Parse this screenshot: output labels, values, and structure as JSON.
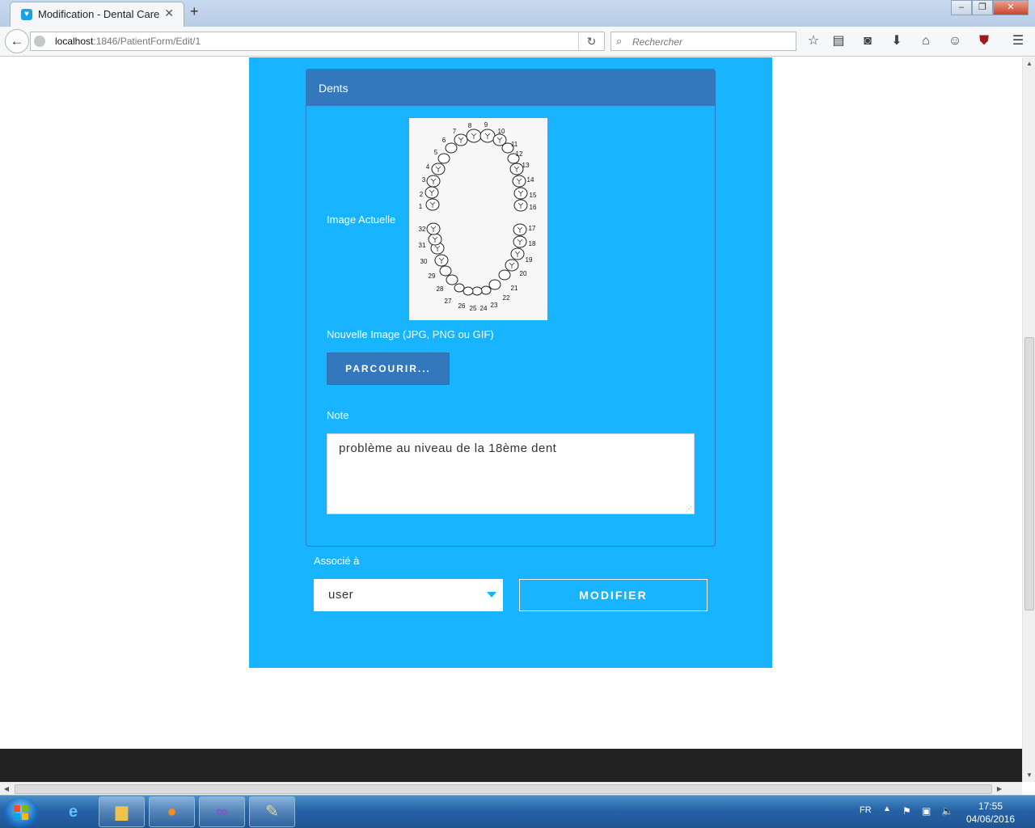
{
  "browser": {
    "tab_title": "Modification - Dental Care",
    "tab_close": "✕",
    "new_tab": "+",
    "url_host": "localhost",
    "url_path": ":1846/PatientForm/Edit/1",
    "search_placeholder": "Rechercher",
    "window_controls": [
      "‒",
      "❐",
      "✕"
    ]
  },
  "form": {
    "section_title": "Dents",
    "current_image_label": "Image Actuelle",
    "new_image_label": "Nouvelle Image (JPG, PNG ou GIF)",
    "browse_button": "PARCOURIR...",
    "note_label": "Note",
    "note_value": "problème au niveau de la 18ème dent",
    "associated_label": "Associé à",
    "associated_value": "user",
    "submit_button": "MODIFIER"
  },
  "tooth_chart": {
    "tooth_numbers": [
      "1",
      "2",
      "3",
      "4",
      "5",
      "6",
      "7",
      "8",
      "9",
      "10",
      "11",
      "12",
      "13",
      "14",
      "15",
      "16",
      "17",
      "18",
      "19",
      "20",
      "21",
      "22",
      "23",
      "24",
      "25",
      "26",
      "27",
      "28",
      "29",
      "30",
      "31",
      "32"
    ]
  },
  "taskbar": {
    "language": "FR",
    "time": "17:55",
    "date": "04/06/2016",
    "apps": [
      "internet-explorer",
      "file-explorer",
      "firefox",
      "visual-studio",
      "paint"
    ]
  }
}
